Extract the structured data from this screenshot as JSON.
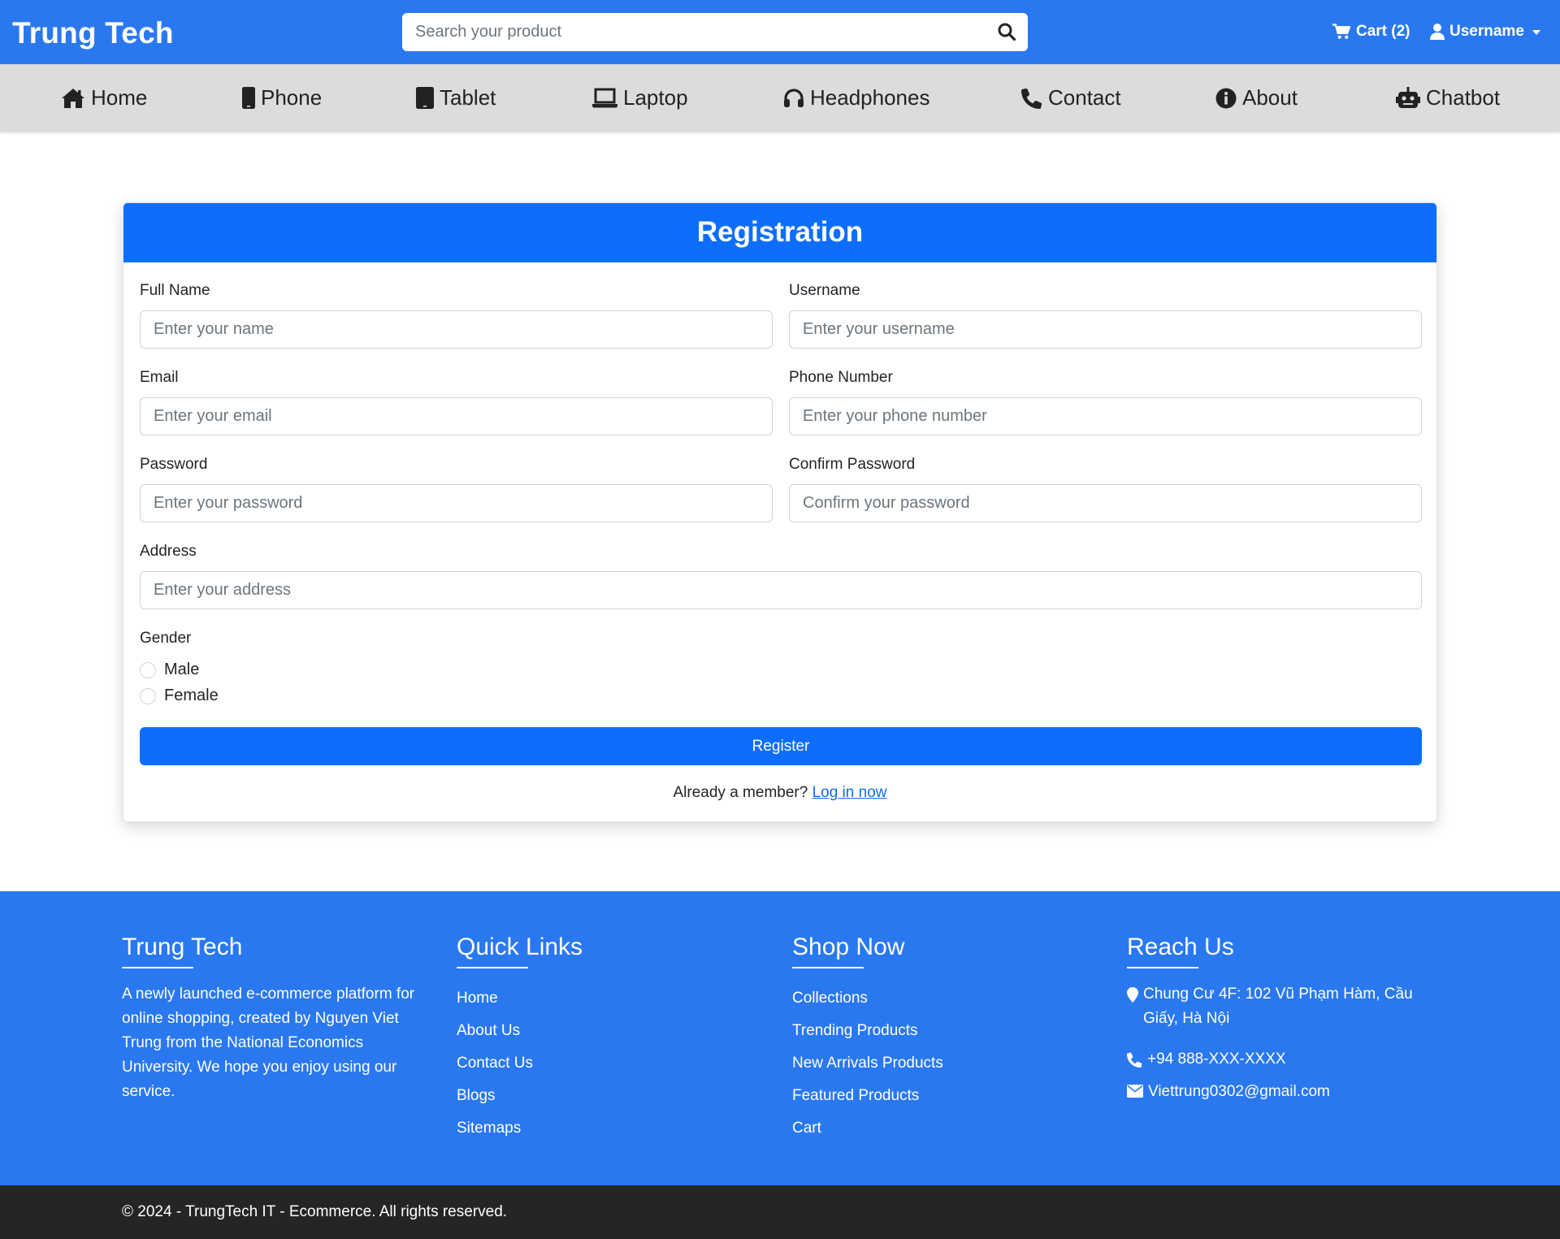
{
  "header": {
    "brand": "Trung Tech",
    "search_placeholder": "Search your product",
    "cart_label": "Cart (2)",
    "user_label": "Username"
  },
  "nav": {
    "items": [
      {
        "label": "Home",
        "icon": "home-icon"
      },
      {
        "label": "Phone",
        "icon": "phone-icon"
      },
      {
        "label": "Tablet",
        "icon": "tablet-icon"
      },
      {
        "label": "Laptop",
        "icon": "laptop-icon"
      },
      {
        "label": "Headphones",
        "icon": "headphones-icon"
      },
      {
        "label": "Contact",
        "icon": "telephone-icon"
      },
      {
        "label": "About",
        "icon": "info-icon"
      },
      {
        "label": "Chatbot",
        "icon": "robot-icon"
      }
    ]
  },
  "form": {
    "title": "Registration",
    "full_name": {
      "label": "Full Name",
      "placeholder": "Enter your name"
    },
    "username": {
      "label": "Username",
      "placeholder": "Enter your username"
    },
    "email": {
      "label": "Email",
      "placeholder": "Enter your email"
    },
    "phone": {
      "label": "Phone Number",
      "placeholder": "Enter your phone number"
    },
    "password": {
      "label": "Password",
      "placeholder": "Enter your password"
    },
    "confirm_password": {
      "label": "Confirm Password",
      "placeholder": "Confirm your password"
    },
    "address": {
      "label": "Address",
      "placeholder": "Enter your address"
    },
    "gender": {
      "label": "Gender",
      "options": [
        "Male",
        "Female"
      ]
    },
    "submit_label": "Register",
    "login_prompt": "Already a member?",
    "login_link": "Log in now"
  },
  "footer": {
    "about": {
      "title": "Trung Tech",
      "text": "A newly launched e-commerce platform for online shopping, created by Nguyen Viet Trung from the National Economics University. We hope you enjoy using our service."
    },
    "quick_links": {
      "title": "Quick Links",
      "items": [
        "Home",
        "About Us",
        "Contact Us",
        "Blogs",
        "Sitemaps"
      ]
    },
    "shop_now": {
      "title": "Shop Now",
      "items": [
        "Collections",
        "Trending Products",
        "New Arrivals Products",
        "Featured Products",
        "Cart"
      ]
    },
    "reach_us": {
      "title": "Reach Us",
      "address": "Chung Cư 4F: 102 Vũ Phạm Hàm, Cầu Giấy, Hà Nội",
      "phone": "+94 888-XXX-XXXX",
      "email": "Viettrung0302@gmail.com"
    },
    "copyright": "© 2024 - TrungTech IT - Ecommerce. All rights reserved."
  },
  "colors": {
    "primary": "#0d6efd",
    "header_blue": "#2a78f0",
    "nav_gray": "#dcdcdc",
    "copyright_bg": "#252525"
  }
}
